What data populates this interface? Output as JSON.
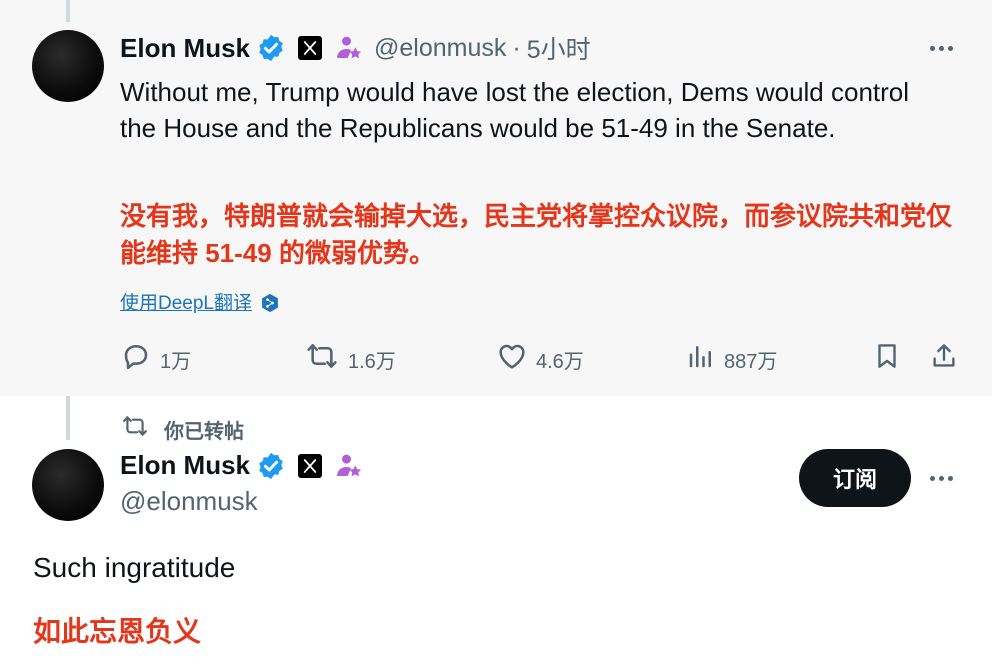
{
  "tweet": {
    "author_name": "Elon Musk",
    "handle": "@elonmusk",
    "separator": "·",
    "time": "5小时",
    "text_en": "Without me, Trump would have lost the election, Dems would control the House and the Republicans would be 51-49 in the Senate.",
    "text_zh": "没有我，特朗普就会输掉大选，民主党将掌控众议院，而参议院共和党仅能维持 51-49 的微弱优势。",
    "translate_label": "使用DeepL翻译",
    "actions": {
      "replies": "1万",
      "reposts": "1.6万",
      "likes": "4.6万",
      "views": "887万"
    }
  },
  "repost_header": {
    "label": "你已转帖"
  },
  "reposted_tweet": {
    "author_name": "Elon Musk",
    "handle": "@elonmusk",
    "subscribe_label": "订阅",
    "text_en": "Such ingratitude",
    "text_zh": "如此忘恩负义"
  },
  "colors": {
    "highlight_red": "#e3361b",
    "verified_blue": "#1d9bf0",
    "affiliate_purple": "#b15fd6",
    "link_blue": "#1d74b8",
    "muted_gray": "#536471"
  },
  "icons": [
    "verified-icon",
    "x-logo-icon",
    "affiliate-badge-icon",
    "more-icon",
    "reply-icon",
    "repost-icon",
    "like-icon",
    "views-icon",
    "bookmark-icon",
    "share-icon",
    "deepl-icon"
  ]
}
